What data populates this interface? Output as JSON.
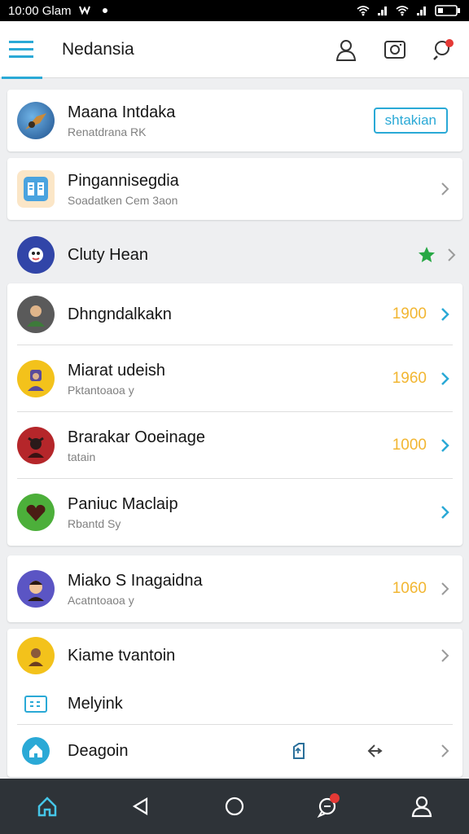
{
  "status_bar": {
    "time": "10:00 Glam",
    "battery": "☐"
  },
  "app_bar": {
    "title": "Nedansia"
  },
  "rows": [
    {
      "title": "Maana Intdaka",
      "subtitle": "Renatdrana RK",
      "action": "shtakian"
    },
    {
      "title": "Pingannisegdia",
      "subtitle": "Soadatken Cem 3aon"
    },
    {
      "title": "Cluty Hean"
    },
    {
      "title": "Dhngndalkakn",
      "value": "1900"
    },
    {
      "title": "Miarat udeish",
      "subtitle": "Pktantoaoa y",
      "value": "1960"
    },
    {
      "title": "Brarakar Ooeinage",
      "subtitle": "tatain",
      "value": "1000"
    },
    {
      "title": "Paniuc Maclaip",
      "subtitle": "Rbantd Sy"
    },
    {
      "title": "Miako S Inagaidna",
      "subtitle": "Acatntoaoa y",
      "value": "1060"
    },
    {
      "title": "Kiame tvantoin"
    },
    {
      "title": "Melyink"
    },
    {
      "title": "Deagoin"
    }
  ],
  "colors": {
    "accent": "#2aa9d6",
    "value": "#f2b632",
    "star": "#27a844",
    "nav_bg": "#2e3338"
  }
}
